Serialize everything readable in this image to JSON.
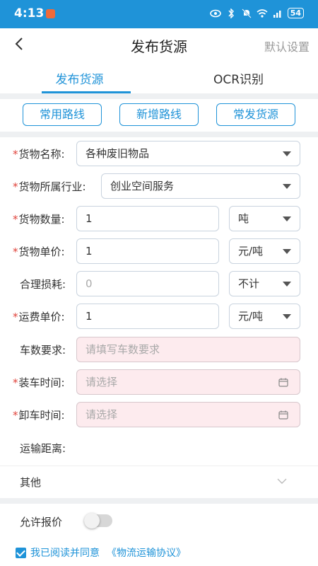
{
  "status_bar": {
    "time": "4:13",
    "battery": "54"
  },
  "header": {
    "title": "发布货源",
    "right_label": "默认设置"
  },
  "tabs": [
    {
      "label": "发布货源"
    },
    {
      "label": "OCR识别"
    }
  ],
  "quick_buttons": [
    {
      "label": "常用路线"
    },
    {
      "label": "新增路线"
    },
    {
      "label": "常发货源"
    }
  ],
  "form": {
    "goods_name": {
      "label": "货物名称:",
      "required": "*",
      "value": "各种废旧物品"
    },
    "industry": {
      "label": "货物所属行业:",
      "required": "*",
      "value": "创业空间服务"
    },
    "quantity": {
      "label": "货物数量:",
      "required": "*",
      "value": "1",
      "unit": "吨"
    },
    "unit_price": {
      "label": "货物单价:",
      "required": "*",
      "value": "1",
      "unit": "元/吨"
    },
    "loss": {
      "label": "合理损耗:",
      "placeholder": "0",
      "unit": "不计"
    },
    "freight_price": {
      "label": "运费单价:",
      "required": "*",
      "value": "1",
      "unit": "元/吨"
    },
    "vehicle_req": {
      "label": "车数要求:",
      "placeholder": "请填写车数要求"
    },
    "load_time": {
      "label": "装车时间:",
      "required": "*",
      "placeholder": "请选择"
    },
    "unload_time": {
      "label": "卸车时间:",
      "required": "*",
      "placeholder": "请选择"
    },
    "distance": {
      "label": "运输距离:"
    }
  },
  "other": {
    "label": "其他"
  },
  "allow_bid": {
    "label": "允许报价"
  },
  "agreement": {
    "prefix": "我已阅读并同意",
    "link": "《物流运输协议》"
  },
  "colors": {
    "accent": "#1f93d8",
    "required": "#e0433b",
    "pink_field": "#fdebee"
  }
}
